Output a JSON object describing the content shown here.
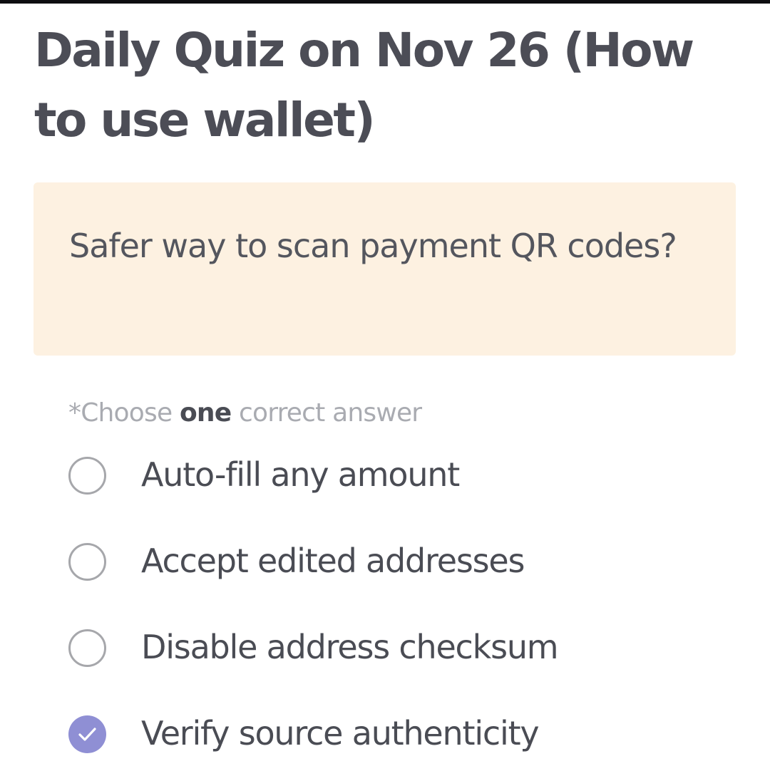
{
  "quiz": {
    "title": "Daily Quiz on Nov 26 (How to use wallet)",
    "question": "Safer way to scan payment QR codes?",
    "instruction": {
      "prefix": "*Choose ",
      "emphasis": "one",
      "suffix": " correct answer"
    },
    "options": [
      {
        "label": "Auto-fill any amount",
        "selected": false
      },
      {
        "label": "Accept edited addresses",
        "selected": false
      },
      {
        "label": "Disable address checksum",
        "selected": false
      },
      {
        "label": "Verify source authenticity",
        "selected": true
      }
    ]
  },
  "colors": {
    "card_background": "#fdf1e1",
    "selected_accent": "#8f8fd4",
    "text_primary": "#4a4c54",
    "text_muted": "#a9abb1"
  },
  "icons": {
    "unselected": "radio-empty-icon",
    "selected": "check-circle-icon"
  }
}
